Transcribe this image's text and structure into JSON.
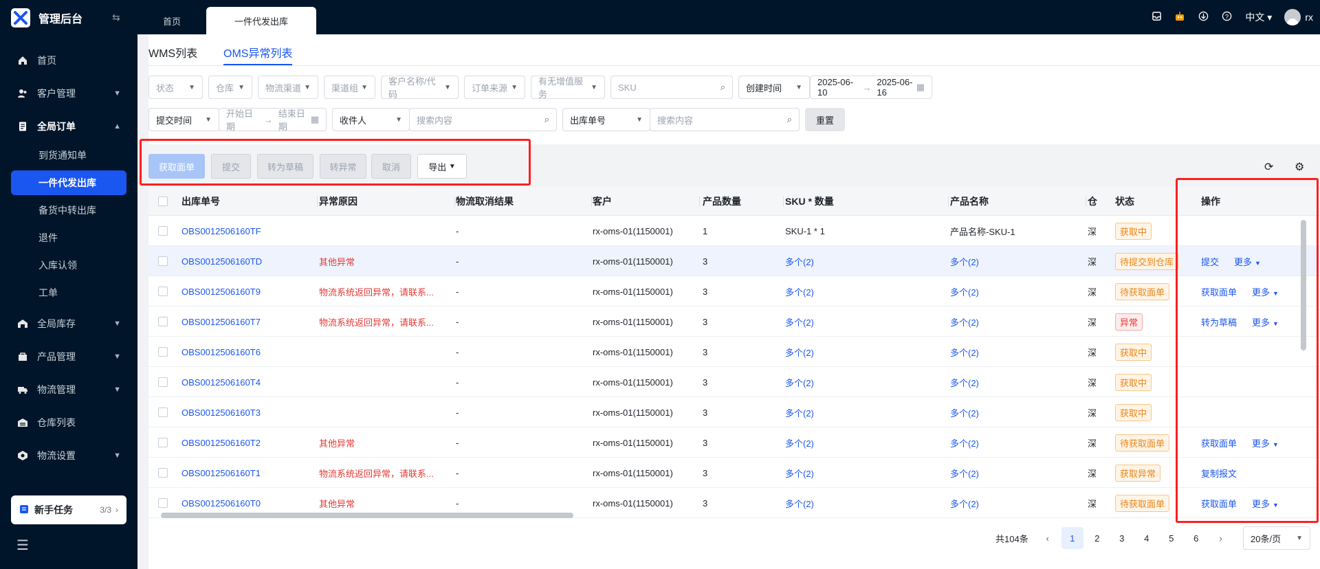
{
  "app": {
    "title": "管理后台"
  },
  "top_tabs": [
    {
      "label": "首页"
    },
    {
      "label": "一件代发出库"
    }
  ],
  "top_right": {
    "lang": "中文",
    "user": "rx"
  },
  "sidebar": {
    "items": [
      {
        "label": "首页",
        "icon": "home-icon"
      },
      {
        "label": "客户管理",
        "icon": "customers-icon"
      },
      {
        "label": "全局订单",
        "icon": "orders-icon"
      },
      {
        "label": "全局库存",
        "icon": "inventory-icon"
      },
      {
        "label": "产品管理",
        "icon": "product-icon"
      },
      {
        "label": "物流管理",
        "icon": "truck-icon"
      },
      {
        "label": "仓库列表",
        "icon": "warehouse-icon"
      },
      {
        "label": "物流设置",
        "icon": "logistics-settings-icon"
      }
    ],
    "sub_items": [
      {
        "label": "到货通知单"
      },
      {
        "label": "一件代发出库"
      },
      {
        "label": "备货中转出库"
      },
      {
        "label": "退件"
      },
      {
        "label": "入库认领"
      },
      {
        "label": "工单"
      }
    ],
    "newbie": {
      "label": "新手任务",
      "count": "3/3"
    }
  },
  "subtabs": [
    {
      "label": "WMS列表"
    },
    {
      "label": "OMS异常列表"
    }
  ],
  "filters": {
    "row1": [
      {
        "placeholder": "状态"
      },
      {
        "placeholder": "仓库"
      },
      {
        "placeholder": "物流渠道"
      },
      {
        "placeholder": "渠道组"
      },
      {
        "placeholder": "客户名称/代码"
      },
      {
        "placeholder": "订单来源"
      },
      {
        "placeholder": "有无增值服务"
      }
    ],
    "sku_placeholder": "SKU",
    "time_type": "创建时间",
    "date_start": "2025-06-10",
    "date_end": "2025-06-16",
    "submit_time": "提交时间",
    "start_ph": "开始日期",
    "end_ph": "结束日期",
    "receiver": "收件人",
    "search_ph": "搜索内容",
    "order_no": "出库单号",
    "search_ph2": "搜索内容",
    "reset": "重置"
  },
  "toolbar": {
    "get_label": "获取面单",
    "submit": "提交",
    "to_draft": "转为草稿",
    "to_abnormal": "转异常",
    "cancel": "取消",
    "export": "导出"
  },
  "columns": {
    "order_no": "出库单号",
    "reason": "异常原因",
    "cancel_result": "物流取消结果",
    "customer": "客户",
    "qty": "产品数量",
    "sku_qty": "SKU * 数量",
    "product_name": "产品名称",
    "hidden": "仓",
    "status": "状态",
    "ops": "操作"
  },
  "rows": [
    {
      "no": "OBS0012506160TF",
      "reason": "",
      "cancel": "-",
      "customer": "rx-oms-01(1150001)",
      "qty": "1",
      "sku": "SKU-1 * 1",
      "sku_link": false,
      "pname": "产品名称-SKU-1",
      "pname_link": false,
      "wh": "深",
      "status": "获取中",
      "status_color": "orange",
      "op1": "",
      "op2": ""
    },
    {
      "no": "OBS0012506160TD",
      "reason": "其他异常",
      "cancel": "-",
      "customer": "rx-oms-01(1150001)",
      "qty": "3",
      "sku": "多个(2)",
      "sku_link": true,
      "pname": "多个(2)",
      "pname_link": true,
      "wh": "深",
      "status": "待提交到仓库",
      "status_color": "orange",
      "op1": "提交",
      "op2": "更多"
    },
    {
      "no": "OBS0012506160T9",
      "reason": "物流系统返回异常，请联系...",
      "cancel": "-",
      "customer": "rx-oms-01(1150001)",
      "qty": "3",
      "sku": "多个(2)",
      "sku_link": true,
      "pname": "多个(2)",
      "pname_link": true,
      "wh": "深",
      "status": "待获取面单",
      "status_color": "orange",
      "op1": "获取面单",
      "op2": "更多"
    },
    {
      "no": "OBS0012506160T7",
      "reason": "物流系统返回异常，请联系...",
      "cancel": "-",
      "customer": "rx-oms-01(1150001)",
      "qty": "3",
      "sku": "多个(2)",
      "sku_link": true,
      "pname": "多个(2)",
      "pname_link": true,
      "wh": "深",
      "status": "异常",
      "status_color": "red",
      "op1": "转为草稿",
      "op2": "更多"
    },
    {
      "no": "OBS0012506160T6",
      "reason": "",
      "cancel": "-",
      "customer": "rx-oms-01(1150001)",
      "qty": "3",
      "sku": "多个(2)",
      "sku_link": true,
      "pname": "多个(2)",
      "pname_link": true,
      "wh": "深",
      "status": "获取中",
      "status_color": "orange",
      "op1": "",
      "op2": ""
    },
    {
      "no": "OBS0012506160T4",
      "reason": "",
      "cancel": "-",
      "customer": "rx-oms-01(1150001)",
      "qty": "3",
      "sku": "多个(2)",
      "sku_link": true,
      "pname": "多个(2)",
      "pname_link": true,
      "wh": "深",
      "status": "获取中",
      "status_color": "orange",
      "op1": "",
      "op2": ""
    },
    {
      "no": "OBS0012506160T3",
      "reason": "",
      "cancel": "-",
      "customer": "rx-oms-01(1150001)",
      "qty": "3",
      "sku": "多个(2)",
      "sku_link": true,
      "pname": "多个(2)",
      "pname_link": true,
      "wh": "深",
      "status": "获取中",
      "status_color": "orange",
      "op1": "",
      "op2": ""
    },
    {
      "no": "OBS0012506160T2",
      "reason": "其他异常",
      "cancel": "-",
      "customer": "rx-oms-01(1150001)",
      "qty": "3",
      "sku": "多个(2)",
      "sku_link": true,
      "pname": "多个(2)",
      "pname_link": true,
      "wh": "深",
      "status": "待获取面单",
      "status_color": "orange",
      "op1": "获取面单",
      "op2": "更多"
    },
    {
      "no": "OBS0012506160T1",
      "reason": "物流系统返回异常，请联系...",
      "cancel": "-",
      "customer": "rx-oms-01(1150001)",
      "qty": "3",
      "sku": "多个(2)",
      "sku_link": true,
      "pname": "多个(2)",
      "pname_link": true,
      "wh": "深",
      "status": "获取异常",
      "status_color": "orange",
      "op1": "复制报文",
      "op2": ""
    },
    {
      "no": "OBS0012506160T0",
      "reason": "其他异常",
      "cancel": "-",
      "customer": "rx-oms-01(1150001)",
      "qty": "3",
      "sku": "多个(2)",
      "sku_link": true,
      "pname": "多个(2)",
      "pname_link": true,
      "wh": "深",
      "status": "待获取面单",
      "status_color": "orange",
      "op1": "获取面单",
      "op2": "更多"
    }
  ],
  "pagination": {
    "total": "共104条",
    "pages": [
      "1",
      "2",
      "3",
      "4",
      "5",
      "6"
    ],
    "current": "1",
    "page_size": "20条/页"
  },
  "colors": {
    "accent": "#1a56f0",
    "sidebar": "#001529",
    "highlight": "#ff1f1f"
  }
}
